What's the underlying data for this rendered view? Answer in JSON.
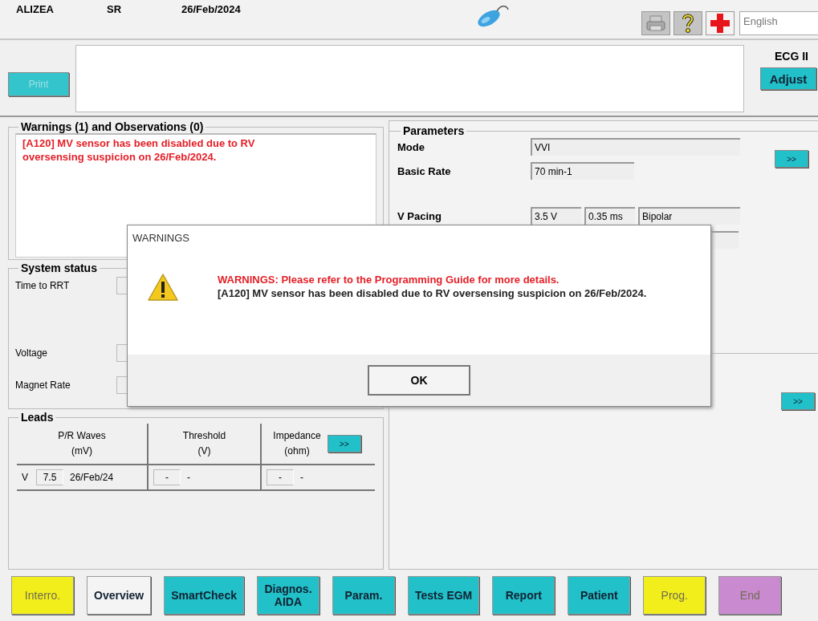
{
  "header": {
    "device": "ALIZEA",
    "rhythm": "SR",
    "date": "26/Feb/2024",
    "language": "English"
  },
  "print_button": {
    "label": "Print",
    "disabled": true
  },
  "ecg": {
    "label": "ECG II",
    "button": "Adjust"
  },
  "warnings": {
    "title": "Warnings (1) and Observations (0)",
    "items": [
      "[A120] MV sensor has been disabled due to RV oversensing suspicion on 26/Feb/2024."
    ]
  },
  "system_status": {
    "title": "System status",
    "rows": [
      {
        "label": "Time to RRT"
      },
      {
        "label": "Voltage"
      },
      {
        "label": "Magnet Rate"
      }
    ]
  },
  "leads": {
    "title": "Leads",
    "columns": [
      {
        "title": "P/R Waves",
        "unit": "(mV)"
      },
      {
        "title": "Threshold",
        "unit": "(V)"
      },
      {
        "title": "Impedance",
        "unit": "(ohm)"
      }
    ],
    "more_button": ">>",
    "rows": [
      {
        "chamber": "V",
        "cells": [
          {
            "value": "7.5",
            "date": "26/Feb/24"
          },
          {
            "value": "-",
            "date": "-"
          },
          {
            "value": "-",
            "date": "-"
          }
        ]
      }
    ]
  },
  "parameters": {
    "title": "Parameters",
    "more_button": ">>",
    "rows": [
      {
        "label": "Mode",
        "kind": "wide",
        "values": [
          "VVI"
        ]
      },
      {
        "label": "Basic Rate",
        "kind": "short",
        "values": [
          "70 min-1"
        ]
      },
      {
        "label": "V Pacing",
        "kind": "triple",
        "values": [
          "3.5 V",
          "0.35 ms",
          "Bipolar"
        ]
      }
    ]
  },
  "lower_panel": {
    "more_button": ">>"
  },
  "dialog": {
    "title": "WARNINGS",
    "heading": "WARNINGS: Please refer to the Programming Guide for more details.",
    "message": "[A120] MV sensor has been disabled due to RV oversensing suspicion on 26/Feb/2024.",
    "button": "OK"
  },
  "nav_buttons": [
    {
      "label": "Interro.",
      "color": "#f2ee1c",
      "disabled": true
    },
    {
      "label": "Overview",
      "color": "#f4f4f4",
      "disabled": false
    },
    {
      "label": "SmartCheck",
      "color": "#22c0c8",
      "disabled": false
    },
    {
      "label": "Diagnos.\nAIDA",
      "color": "#22c0c8",
      "disabled": false
    },
    {
      "label": "Param.",
      "color": "#22c0c8",
      "disabled": false
    },
    {
      "label": "Tests EGM",
      "color": "#22c0c8",
      "disabled": false
    },
    {
      "label": "Report",
      "color": "#22c0c8",
      "disabled": false
    },
    {
      "label": "Patient",
      "color": "#22c0c8",
      "disabled": false
    },
    {
      "label": "Prog.",
      "color": "#f2ee1c",
      "disabled": true
    },
    {
      "label": "End",
      "color": "#c98ad0",
      "disabled": true
    }
  ]
}
